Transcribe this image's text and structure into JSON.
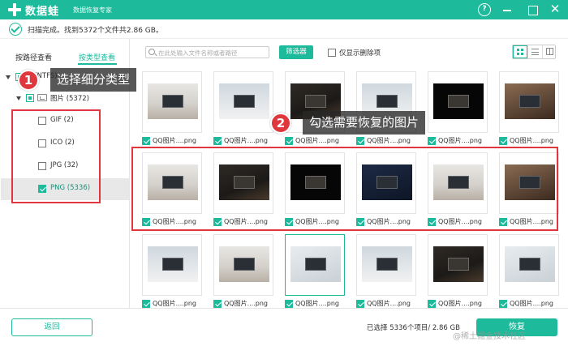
{
  "titlebar": {
    "app_name": "数据蛙",
    "app_subtitle": "数据恢复专家",
    "help_label": "?",
    "close_label": "✕"
  },
  "status": {
    "text": "扫描完成。找到5372个文件共2.86 GB。"
  },
  "sidebar": {
    "tab_path": "按路径查看",
    "tab_type": "按类型查看",
    "drive_label": "E:(NTFS)",
    "images_folder_label": "图片 (5372)",
    "file_types": [
      {
        "label": "GIF (2)",
        "checked": false
      },
      {
        "label": "ICO (2)",
        "checked": false
      },
      {
        "label": "JPG (32)",
        "checked": false
      },
      {
        "label": "PNG (5336)",
        "checked": true
      }
    ]
  },
  "toolbar": {
    "search_placeholder": "在此处输入文件名称或者路径",
    "filter_label": "筛选器",
    "show_deleted_label": "仅显示删除项"
  },
  "grid": {
    "file_label": "QQ图片....png",
    "rows": [
      [
        {
          "style": "desk-light",
          "checked": true,
          "selected": false
        },
        {
          "style": "cool",
          "checked": true,
          "selected": false
        },
        {
          "style": "dark",
          "checked": true,
          "selected": false
        },
        {
          "style": "cool",
          "checked": true,
          "selected": false
        },
        {
          "style": "black",
          "checked": true,
          "selected": false
        },
        {
          "style": "warm",
          "checked": true,
          "selected": false
        }
      ],
      [
        {
          "style": "desk-light",
          "checked": true,
          "selected": false
        },
        {
          "style": "dark",
          "checked": true,
          "selected": false
        },
        {
          "style": "black",
          "checked": true,
          "selected": false
        },
        {
          "style": "blue",
          "checked": true,
          "selected": false
        },
        {
          "style": "desk-light",
          "checked": true,
          "selected": false
        },
        {
          "style": "warm",
          "checked": true,
          "selected": false
        }
      ],
      [
        {
          "style": "cool",
          "checked": true,
          "selected": false
        },
        {
          "style": "desk-light",
          "checked": true,
          "selected": false
        },
        {
          "style": "pink",
          "checked": true,
          "selected": true
        },
        {
          "style": "cool",
          "checked": true,
          "selected": false
        },
        {
          "style": "dark",
          "checked": true,
          "selected": false
        },
        {
          "style": "pink",
          "checked": true,
          "selected": false
        }
      ]
    ]
  },
  "callouts": [
    {
      "number": "1",
      "text": "选择细分类型"
    },
    {
      "number": "2",
      "text": "勾选需要恢复的图片"
    }
  ],
  "footer": {
    "back_label": "返回",
    "selected_info": "已选择 5336个项目/ 2.86 GB",
    "recover_label": "恢复",
    "watermark": "@稀土掘金技术社区"
  },
  "colors": {
    "accent": "#1dba9b",
    "highlight": "#e0363d"
  }
}
